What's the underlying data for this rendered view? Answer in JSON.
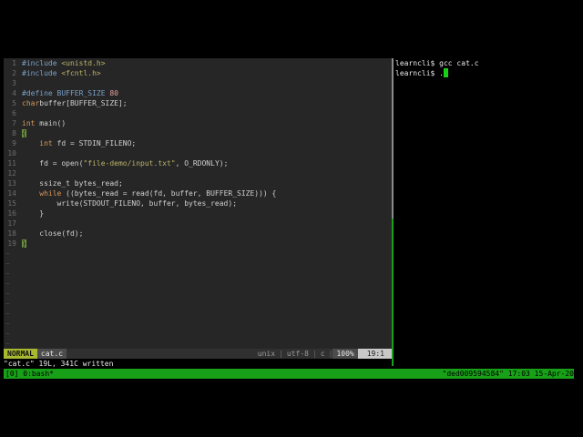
{
  "editor": {
    "lines": [
      {
        "n": "1",
        "parts": [
          [
            "pp",
            "#include "
          ],
          [
            "str",
            "<unistd.h>"
          ]
        ]
      },
      {
        "n": "2",
        "parts": [
          [
            "pp",
            "#include "
          ],
          [
            "str",
            "<fcntl.h>"
          ]
        ]
      },
      {
        "n": "3",
        "parts": []
      },
      {
        "n": "4",
        "parts": [
          [
            "pp",
            "#define BUFFER_SIZE "
          ],
          [
            "num",
            "80"
          ]
        ]
      },
      {
        "n": "5",
        "parts": [
          [
            "kw",
            "char"
          ],
          [
            "",
            "buffer[BUFFER_SIZE];"
          ]
        ]
      },
      {
        "n": "6",
        "parts": []
      },
      {
        "n": "7",
        "parts": [
          [
            "kw",
            "int"
          ],
          [
            "",
            " main()"
          ]
        ]
      },
      {
        "n": "8",
        "parts": [
          [
            "cur",
            "{"
          ]
        ]
      },
      {
        "n": "9",
        "parts": [
          [
            "",
            "    "
          ],
          [
            "kw",
            "int"
          ],
          [
            "",
            " fd = STDIN_FILENO;"
          ]
        ]
      },
      {
        "n": "10",
        "parts": []
      },
      {
        "n": "11",
        "parts": [
          [
            "",
            "    fd = open("
          ],
          [
            "str",
            "\"file-demo/input.txt\""
          ],
          [
            "",
            ", O_RDONLY);"
          ]
        ]
      },
      {
        "n": "12",
        "parts": []
      },
      {
        "n": "13",
        "parts": [
          [
            "",
            "    ssize_t bytes_read;"
          ]
        ]
      },
      {
        "n": "14",
        "parts": [
          [
            "",
            "    "
          ],
          [
            "kw",
            "while"
          ],
          [
            "",
            " ((bytes_read = read(fd, buffer, BUFFER_SIZE))) {"
          ]
        ]
      },
      {
        "n": "15",
        "parts": [
          [
            "",
            "        write(STDOUT_FILENO, buffer, bytes_read);"
          ]
        ]
      },
      {
        "n": "16",
        "parts": [
          [
            "",
            "    }"
          ]
        ]
      },
      {
        "n": "17",
        "parts": []
      },
      {
        "n": "18",
        "parts": [
          [
            "",
            "    close(fd);"
          ]
        ]
      },
      {
        "n": "19",
        "parts": [
          [
            "cur",
            "}"
          ]
        ]
      }
    ],
    "tilde": "~"
  },
  "statusline": {
    "mode": "NORMAL",
    "filename": "cat.c",
    "format": "unix",
    "encoding": "utf-8",
    "filetype": "c",
    "percent": "100%",
    "position": "19:1"
  },
  "message": "\"cat.c\" 19L, 341C written",
  "terminal": {
    "lines": [
      "learncli$ gcc cat.c",
      "learncli$ ."
    ]
  },
  "tmux": {
    "left": "[0] 0:bash*",
    "right": "\"ded009594584\" 17:03 15-Apr-20"
  },
  "colors": {
    "mode_bg": "#a8b830",
    "tmux_bg": "#18a018",
    "cursor": "#18d018",
    "editor_bg": "#262626"
  }
}
